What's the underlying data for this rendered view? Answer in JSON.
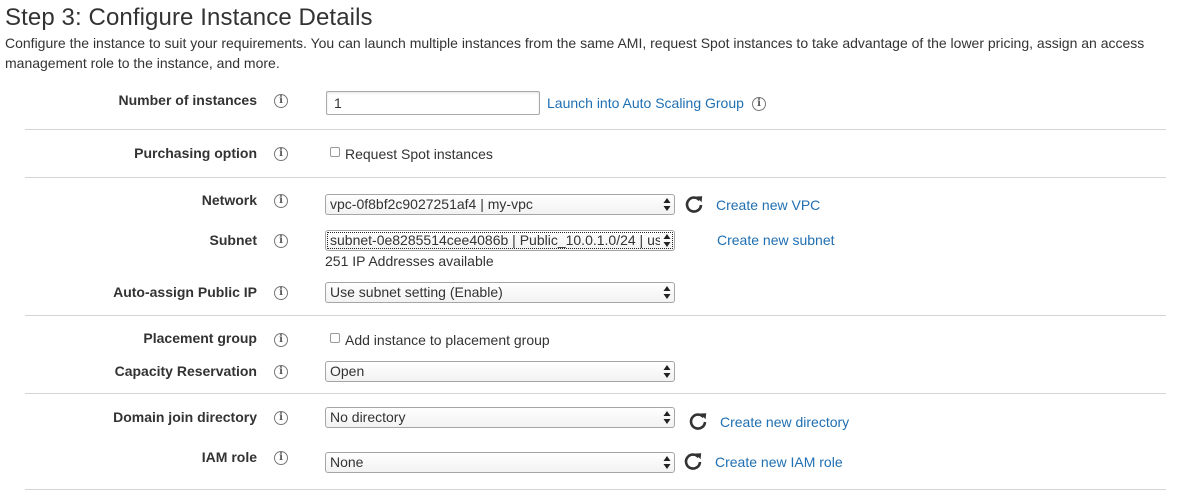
{
  "page": {
    "title": "Step 3: Configure Instance Details",
    "description": "Configure the instance to suit your requirements. You can launch multiple instances from the same AMI, request Spot instances to take advantage of the lower pricing, assign an access management role to the instance, and more."
  },
  "info_glyph": "i",
  "fields": {
    "number_of_instances": {
      "label": "Number of instances",
      "value": "1",
      "link": "Launch into Auto Scaling Group"
    },
    "purchasing_option": {
      "label": "Purchasing option",
      "checkbox_label": "Request Spot instances",
      "checked": false
    },
    "network": {
      "label": "Network",
      "selected": "vpc-0f8bf2c9027251af4 | my-vpc",
      "link": "Create new VPC"
    },
    "subnet": {
      "label": "Subnet",
      "selected": "subnet-0e8285514cee4086b | Public_10.0.1.0/24 | us-",
      "note": "251 IP Addresses available",
      "link": "Create new subnet"
    },
    "auto_assign_public_ip": {
      "label": "Auto-assign Public IP",
      "selected": "Use subnet setting (Enable)"
    },
    "placement_group": {
      "label": "Placement group",
      "checkbox_label": "Add instance to placement group",
      "checked": false
    },
    "capacity_reservation": {
      "label": "Capacity Reservation",
      "selected": "Open"
    },
    "domain_join_directory": {
      "label": "Domain join directory",
      "selected": "No directory",
      "link": "Create new directory"
    },
    "iam_role": {
      "label": "IAM role",
      "selected": "None",
      "link": "Create new IAM role"
    }
  },
  "colors": {
    "link": "#1f6fb2",
    "text": "#333333",
    "divider": "#d5d5d5"
  },
  "icons": {
    "info": "info-icon",
    "refresh": "refresh-icon",
    "select_arrows": "select-arrows-icon"
  }
}
